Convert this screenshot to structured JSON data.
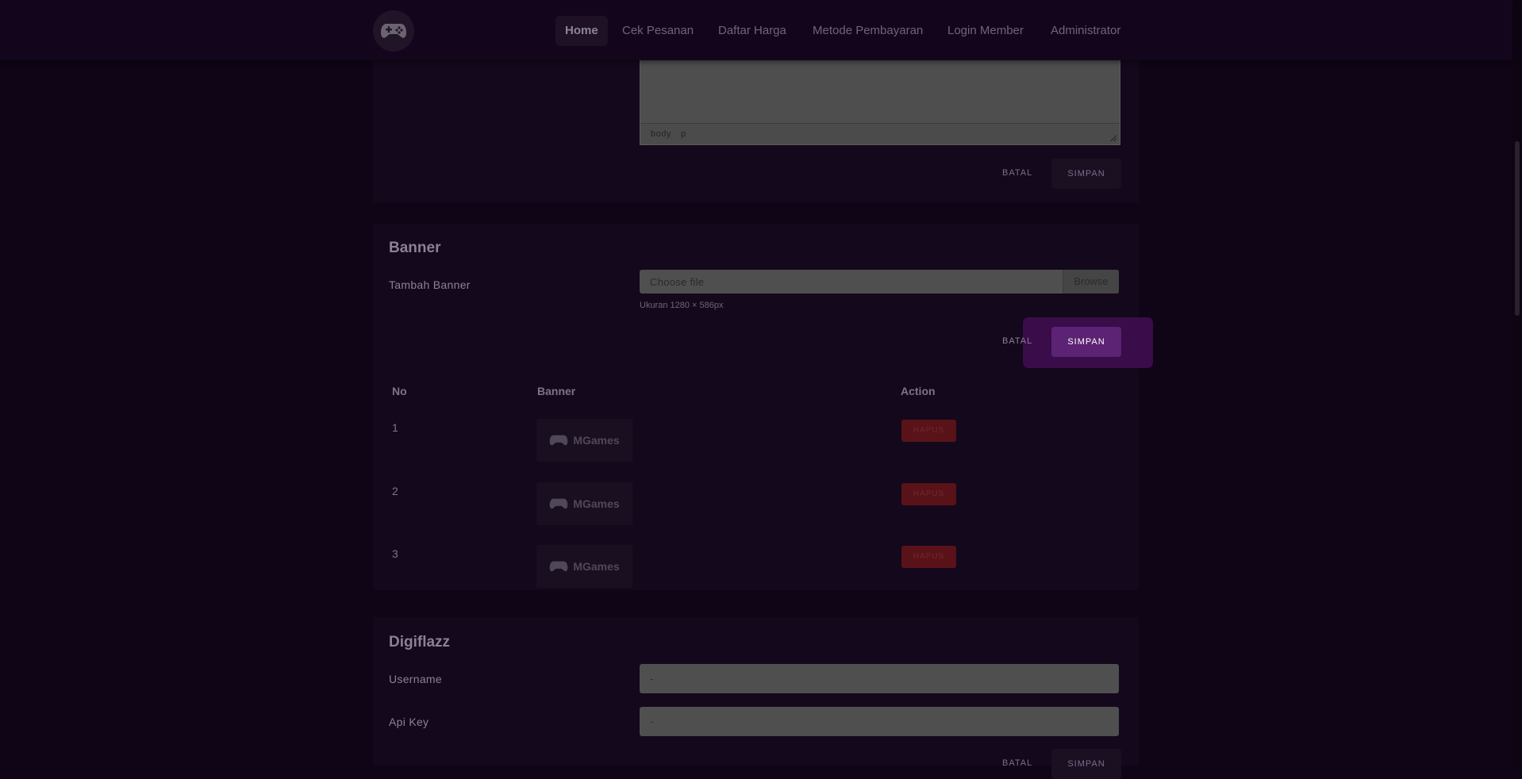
{
  "nav": {
    "items": [
      {
        "label": "Home",
        "active": true
      },
      {
        "label": "Cek Pesanan"
      },
      {
        "label": "Daftar Harga"
      },
      {
        "label": "Metode Pembayaran"
      },
      {
        "label": "Login Member"
      },
      {
        "label": "Administrator"
      }
    ]
  },
  "editor": {
    "status_body": "body",
    "status_p": "p",
    "cancel_label": "BATAL",
    "save_label": "SIMPAN"
  },
  "banner": {
    "title": "Banner",
    "add_label": "Tambah Banner",
    "file_placeholder": "Choose file",
    "browse_label": "Browse",
    "size_hint": "Ukuran 1280 × 586px",
    "cancel_label": "BATAL",
    "save_label": "SIMPAN",
    "table": {
      "headers": [
        "No",
        "Banner",
        "Action"
      ],
      "rows": [
        {
          "no": "1",
          "banner_text": "MGames",
          "action_label": "HAPUS"
        },
        {
          "no": "2",
          "banner_text": "MGames",
          "action_label": "HAPUS"
        },
        {
          "no": "3",
          "banner_text": "MGames",
          "action_label": "HAPUS"
        }
      ]
    }
  },
  "digiflazz": {
    "title": "Digiflazz",
    "username_label": "Username",
    "username_value": "-",
    "apikey_label": "Api Key",
    "apikey_value": "-",
    "cancel_label": "BATAL",
    "save_label": "SIMPAN"
  },
  "colors": {
    "background": "#0f0517",
    "card": "#14081c",
    "accent": "#5c2273",
    "danger": "#5a1219"
  }
}
